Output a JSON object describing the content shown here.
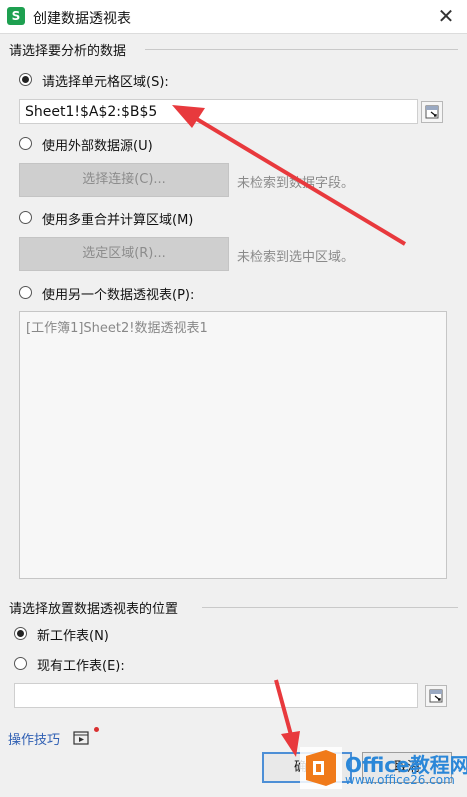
{
  "window": {
    "title": "创建数据透视表"
  },
  "source_section": {
    "legend": "请选择要分析的数据",
    "option_range": {
      "label": "请选择单元格区域(S):",
      "value": "Sheet1!$A$2:$B$5",
      "checked": true
    },
    "option_external": {
      "label": "使用外部数据源(U)",
      "button_label": "选择连接(C)...",
      "hint": "未检索到数据字段。"
    },
    "option_multi": {
      "label": "使用多重合并计算区域(M)",
      "button_label": "选定区域(R)...",
      "hint": "未检索到选中区域。"
    },
    "option_other_pivot": {
      "label": "使用另一个数据透视表(P):",
      "list_items": [
        "[工作簿1]Sheet2!数据透视表1"
      ]
    }
  },
  "dest_section": {
    "legend": "请选择放置数据透视表的位置",
    "option_new": {
      "label": "新工作表(N)",
      "checked": true
    },
    "option_existing": {
      "label": "现有工作表(E):",
      "value": ""
    }
  },
  "footer": {
    "tips_label": "操作技巧",
    "ok_label": "确定",
    "cancel_label": "取消"
  },
  "watermark": {
    "brand": "Office教程网",
    "url": "www.office26.com"
  },
  "colors": {
    "accent": "#4d8fd6",
    "arrow": "#e8393d",
    "brand": "#2b87d8",
    "logo_orange": "#f07a1a",
    "app_icon": "#1ea050"
  }
}
